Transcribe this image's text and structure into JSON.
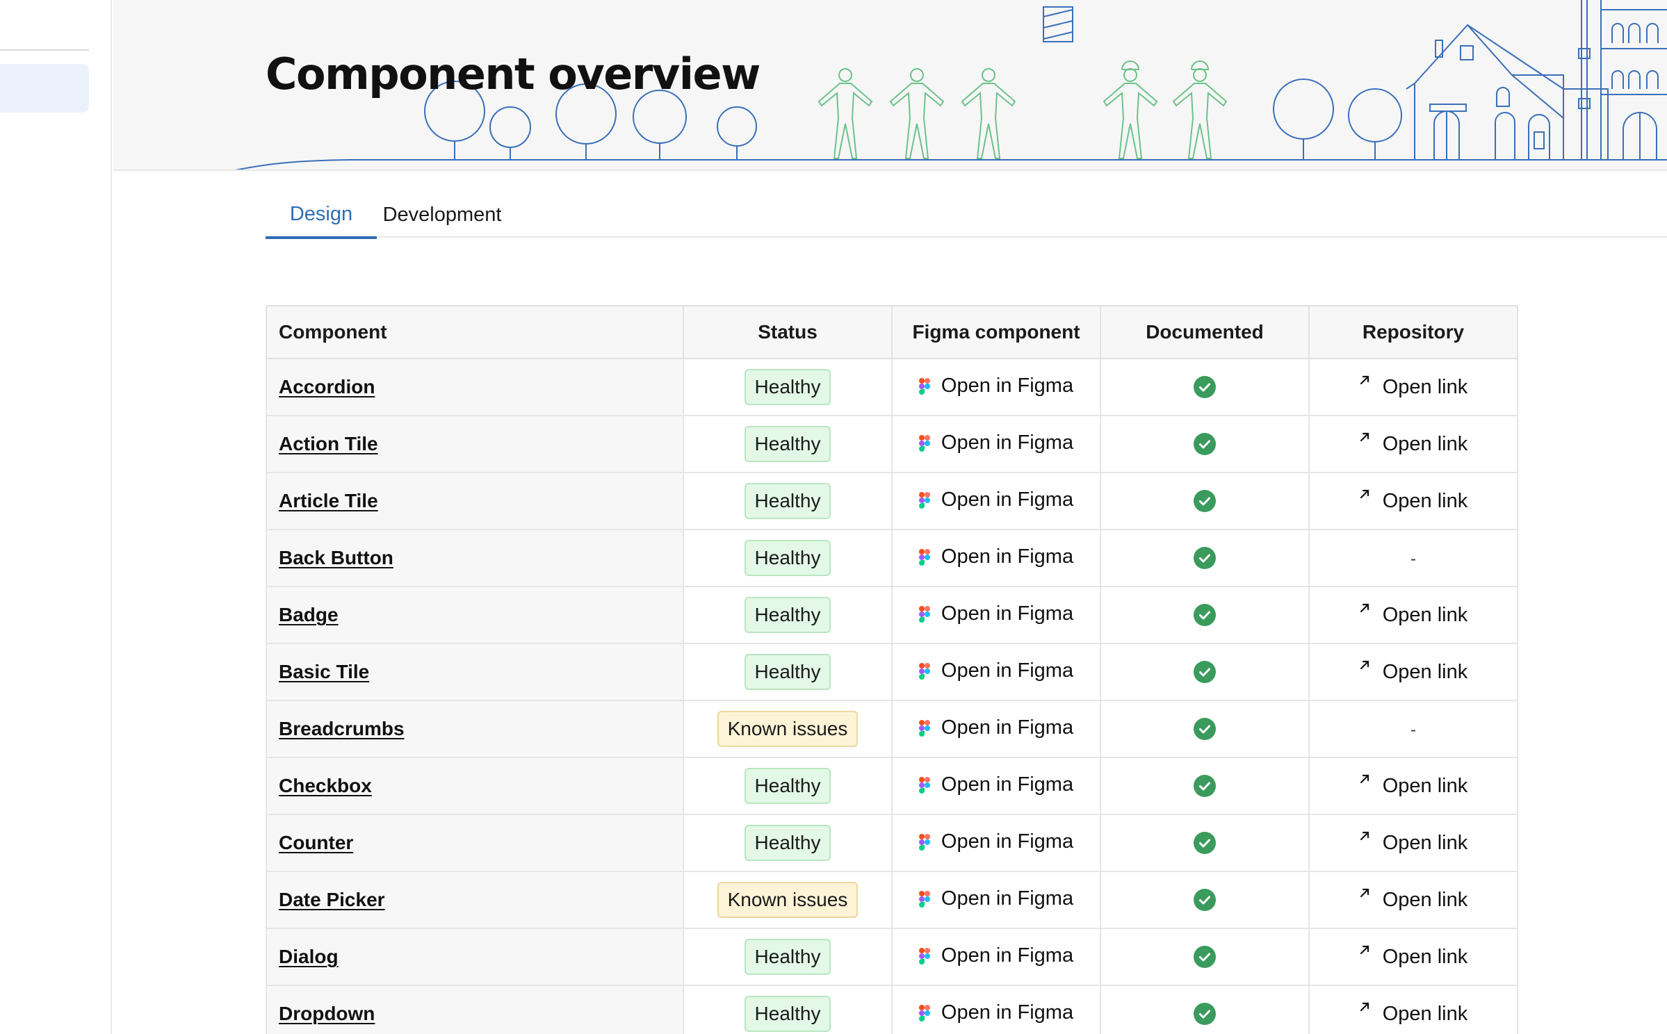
{
  "header": {
    "title": "Component overview"
  },
  "tabs": [
    {
      "label": "Design",
      "active": true
    },
    {
      "label": "Development",
      "active": false
    }
  ],
  "table": {
    "headers": [
      "Component",
      "Status",
      "Figma component",
      "Documented",
      "Repository"
    ],
    "rows": [
      {
        "component": "Accordion",
        "status": "Healthy",
        "status_type": "healthy",
        "figma": "Open in Figma",
        "documented": true,
        "repo": "Open link"
      },
      {
        "component": "Action Tile",
        "status": "Healthy",
        "status_type": "healthy",
        "figma": "Open in Figma",
        "documented": true,
        "repo": "Open link"
      },
      {
        "component": "Article Tile",
        "status": "Healthy",
        "status_type": "healthy",
        "figma": "Open in Figma",
        "documented": true,
        "repo": "Open link"
      },
      {
        "component": "Back Button",
        "status": "Healthy",
        "status_type": "healthy",
        "figma": "Open in Figma",
        "documented": true,
        "repo": "-"
      },
      {
        "component": "Badge",
        "status": "Healthy",
        "status_type": "healthy",
        "figma": "Open in Figma",
        "documented": true,
        "repo": "Open link"
      },
      {
        "component": "Basic Tile",
        "status": "Healthy",
        "status_type": "healthy",
        "figma": "Open in Figma",
        "documented": true,
        "repo": "Open link"
      },
      {
        "component": "Breadcrumbs",
        "status": "Known issues",
        "status_type": "issues",
        "figma": "Open in Figma",
        "documented": true,
        "repo": "-"
      },
      {
        "component": "Checkbox",
        "status": "Healthy",
        "status_type": "healthy",
        "figma": "Open in Figma",
        "documented": true,
        "repo": "Open link"
      },
      {
        "component": "Counter",
        "status": "Healthy",
        "status_type": "healthy",
        "figma": "Open in Figma",
        "documented": true,
        "repo": "Open link"
      },
      {
        "component": "Date Picker",
        "status": "Known issues",
        "status_type": "issues",
        "figma": "Open in Figma",
        "documented": true,
        "repo": "Open link"
      },
      {
        "component": "Dialog",
        "status": "Healthy",
        "status_type": "healthy",
        "figma": "Open in Figma",
        "documented": true,
        "repo": "Open link"
      },
      {
        "component": "Dropdown",
        "status": "Healthy",
        "status_type": "healthy",
        "figma": "Open in Figma",
        "documented": true,
        "repo": "Open link"
      }
    ]
  },
  "icons": {
    "figma": "figma-icon",
    "documented": "check-circle-icon",
    "repo": "external-arrow-icon"
  },
  "colors": {
    "accent": "#2f6db5",
    "healthy_bg": "#e3f8e6",
    "issues_bg": "#fdf3d6",
    "check_green": "#3a9b5c",
    "illustration_blue": "#3a6fb8",
    "illustration_green": "#6cc28a"
  }
}
